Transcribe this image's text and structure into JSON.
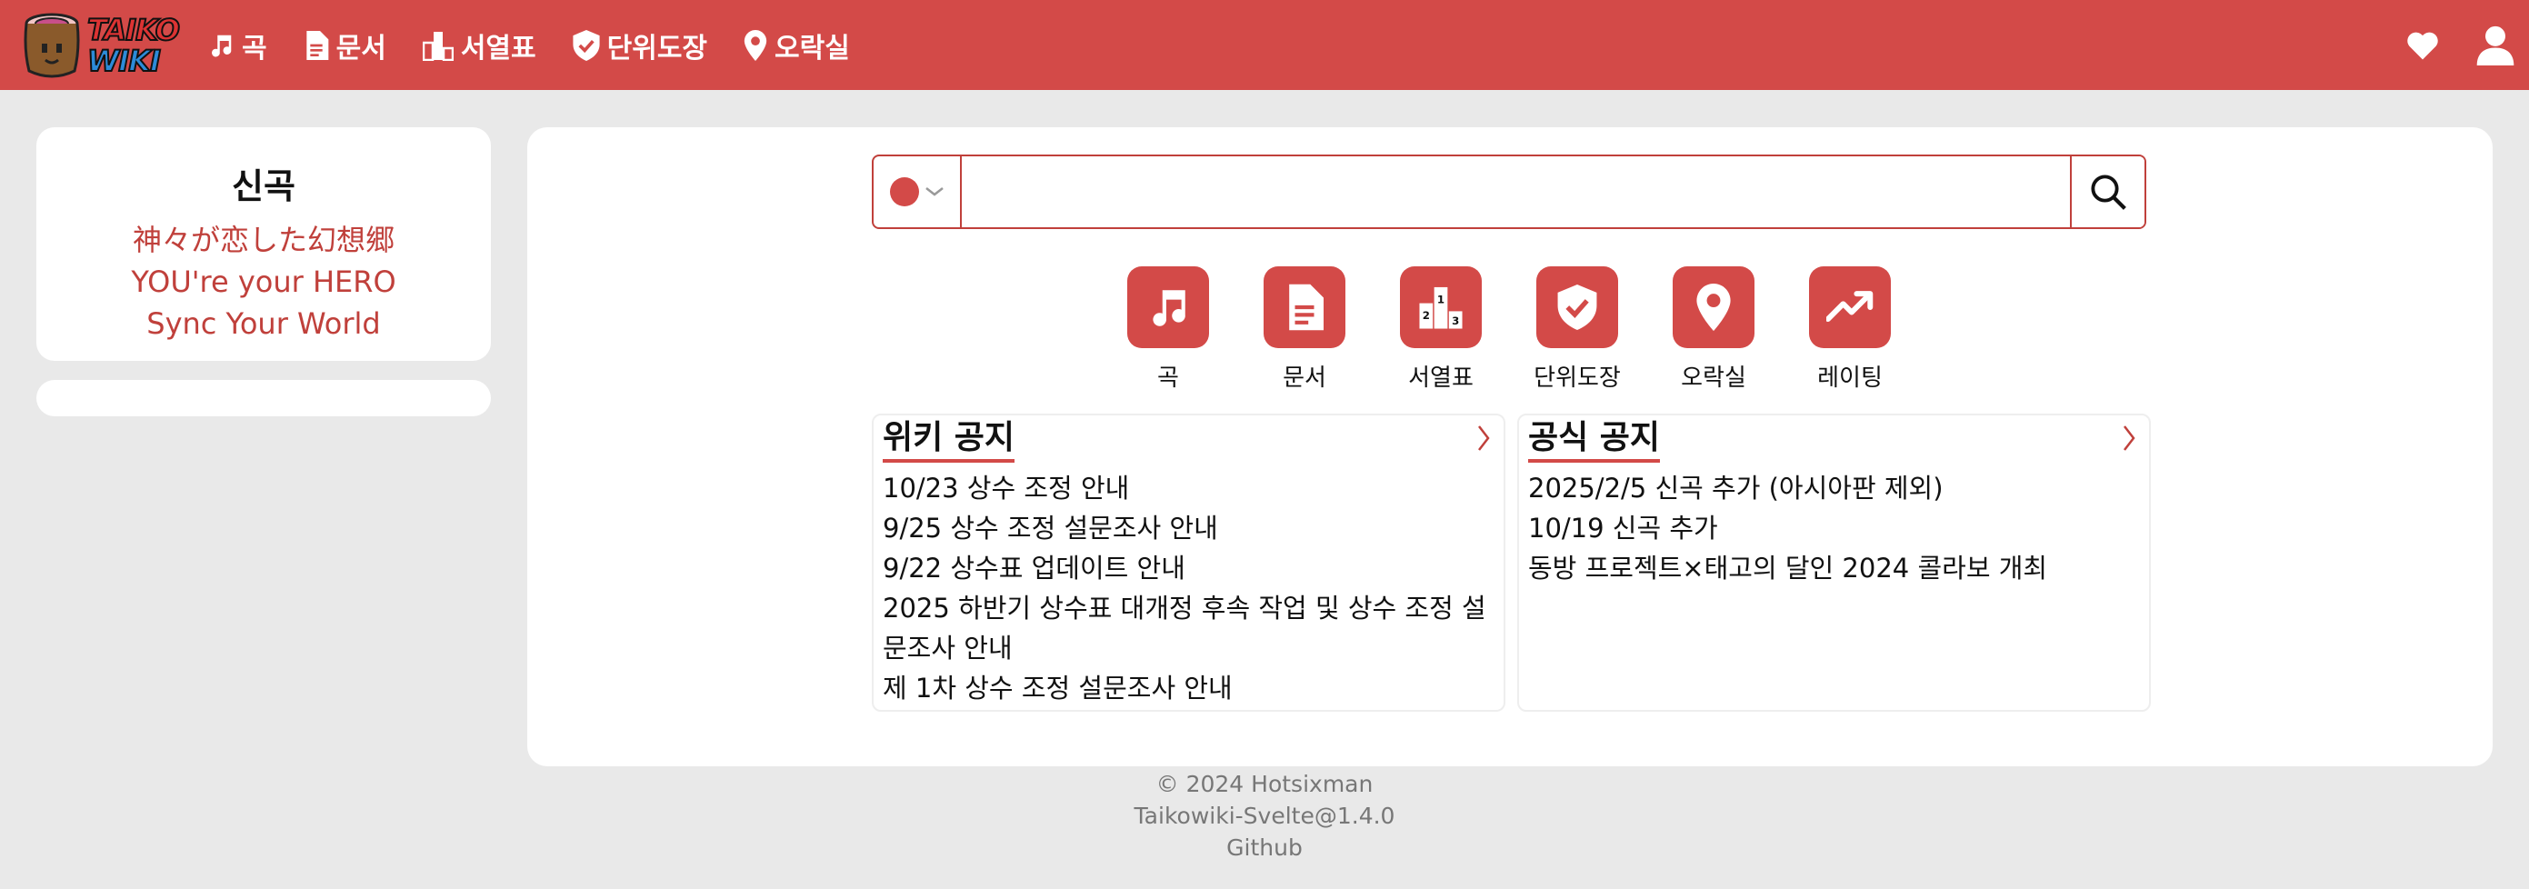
{
  "app": {
    "logo_line1": "TAIKO",
    "logo_line2": "WIKI"
  },
  "nav": {
    "items": [
      {
        "label": "곡",
        "icon": "music-note-icon"
      },
      {
        "label": "문서",
        "icon": "document-icon"
      },
      {
        "label": "서열표",
        "icon": "podium-icon"
      },
      {
        "label": "단위도장",
        "icon": "shield-check-icon"
      },
      {
        "label": "오락실",
        "icon": "map-pin-icon"
      }
    ],
    "right_icons": [
      "heart-icon",
      "user-icon"
    ]
  },
  "sidebar": {
    "title": "신곡",
    "songs": [
      "神々が恋した幻想郷",
      "YOU're your HERO",
      "Sync Your World"
    ]
  },
  "search": {
    "placeholder": "",
    "value": "",
    "lang_indicator_color": "#d34a48"
  },
  "quick_links": [
    {
      "label": "곡",
      "icon": "music-note-icon"
    },
    {
      "label": "문서",
      "icon": "document-icon"
    },
    {
      "label": "서열표",
      "icon": "podium-icon"
    },
    {
      "label": "단위도장",
      "icon": "shield-check-icon"
    },
    {
      "label": "오락실",
      "icon": "map-pin-icon"
    },
    {
      "label": "레이팅",
      "icon": "trending-up-icon"
    }
  ],
  "wiki_notice": {
    "title": "위키 공지",
    "items": [
      "10/23 상수 조정 안내",
      "9/25 상수 조정 설문조사 안내",
      "9/22 상수표 업데이트 안내",
      "2025 하반기 상수표 대개정 후속 작업 및 상수 조정 설문조사 안내",
      "제 1차 상수 조정 설문조사 안내"
    ]
  },
  "official_notice": {
    "title": "공식 공지",
    "items": [
      "2025/2/5 신곡 추가 (아시아판 제외)",
      "10/19 신곡 추가",
      "동방 프로젝트×태고의 달인 2024 콜라보 개최"
    ]
  },
  "footer": {
    "copyright": "© 2024 Hotsixman",
    "version": "Taikowiki-Svelte@1.4.0",
    "github": "Github"
  },
  "colors": {
    "accent": "#d34a48",
    "link": "#c0403b",
    "background": "#e9e9e9"
  }
}
